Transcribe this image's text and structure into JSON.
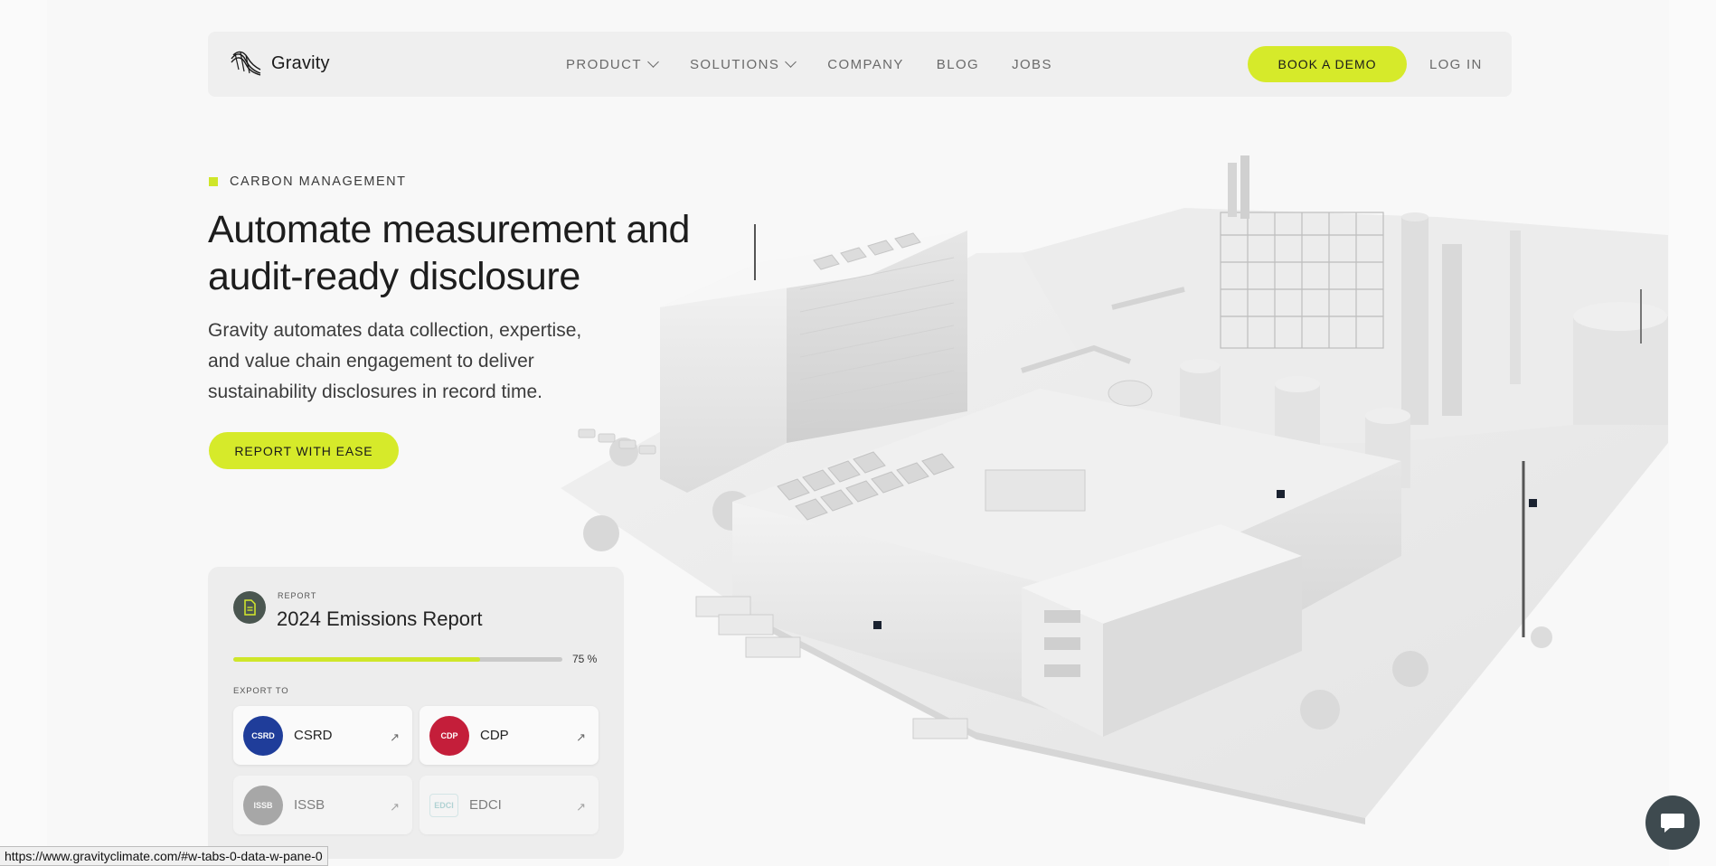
{
  "nav": {
    "logo_text": "Gravity",
    "links": [
      {
        "label": "PRODUCT",
        "has_dropdown": true
      },
      {
        "label": "SOLUTIONS",
        "has_dropdown": true
      },
      {
        "label": "COMPANY",
        "has_dropdown": false
      },
      {
        "label": "BLOG",
        "has_dropdown": false
      },
      {
        "label": "JOBS",
        "has_dropdown": false
      }
    ],
    "cta_label": "BOOK A DEMO",
    "login_label": "LOG IN"
  },
  "hero": {
    "eyebrow": "CARBON MANAGEMENT",
    "title_line1": "Automate measurement and",
    "title_line2": "audit-ready disclosure",
    "subtitle_line1": "Gravity automates data collection, expertise,",
    "subtitle_line2": "and value chain engagement to deliver",
    "subtitle_line3": "sustainability disclosures in record time.",
    "cta_label": "REPORT WITH EASE"
  },
  "report_card": {
    "label": "REPORT",
    "title": "2024 Emissions Report",
    "progress_percent": 75,
    "progress_text": "75 %",
    "export_label": "EXPORT TO",
    "targets": [
      {
        "name": "CSRD",
        "badge_text": "CSRD",
        "color": "#1f3d9a",
        "faded": false
      },
      {
        "name": "CDP",
        "badge_text": "CDP",
        "color": "#c41e3a",
        "faded": false
      },
      {
        "name": "ISSB",
        "badge_text": "ISSB",
        "color": "#6e6e6e",
        "faded": true
      },
      {
        "name": "EDCI",
        "badge_text": "EDCI",
        "color": "#9ad0d2",
        "faded": true
      }
    ]
  },
  "status_url": "https://www.gravityclimate.com/#w-tabs-0-data-w-pane-0",
  "colors": {
    "accent": "#d6ea2a",
    "nav_bg": "#efefef",
    "page_bg": "#f8f8f8",
    "chat_bg": "#3e4a4f"
  },
  "icons": {
    "logo": "gravity-wave-logo-icon",
    "report": "document-icon",
    "chat": "chat-bubble-icon",
    "tile_arrow": "arrow-up-right-icon"
  }
}
